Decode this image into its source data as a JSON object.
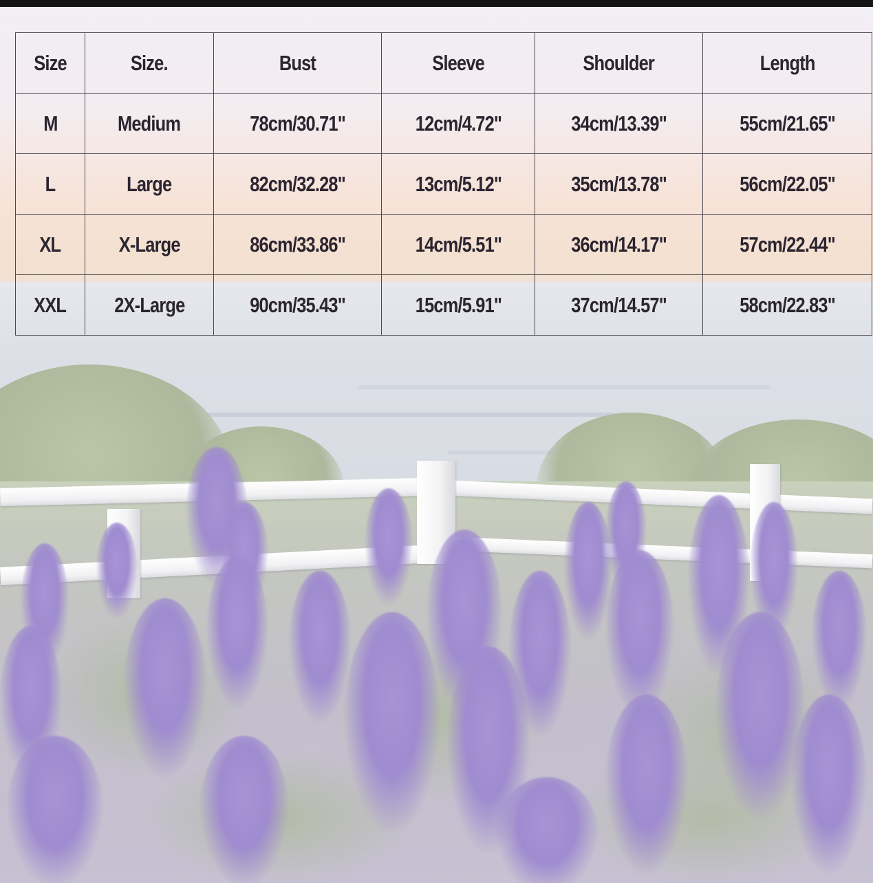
{
  "size_chart": {
    "headers": [
      "Size",
      "Size.",
      "Bust",
      "Sleeve",
      "Shoulder",
      "Length"
    ],
    "rows": [
      [
        "M",
        "Medium",
        "78cm/30.71\"",
        "12cm/4.72\"",
        "34cm/13.39\"",
        "55cm/21.65\""
      ],
      [
        "L",
        "Large",
        "82cm/32.28\"",
        "13cm/5.12\"",
        "35cm/13.78\"",
        "56cm/22.05\""
      ],
      [
        "XL",
        "X-Large",
        "86cm/33.86\"",
        "14cm/5.51\"",
        "36cm/14.17\"",
        "57cm/22.44\""
      ],
      [
        "XXL",
        "2X-Large",
        "90cm/35.43\"",
        "15cm/5.91\"",
        "37cm/14.57\"",
        "58cm/22.83\""
      ]
    ]
  },
  "background": {
    "scene": "lavender field with white fence overlooking the sea",
    "colors": {
      "lavender": "#a893d6",
      "sky_glow": "#f7e3d8",
      "sea": "#dcdfe6",
      "fence": "#ffffff",
      "table_border": "#4d4950",
      "text": "#2b2530"
    }
  }
}
